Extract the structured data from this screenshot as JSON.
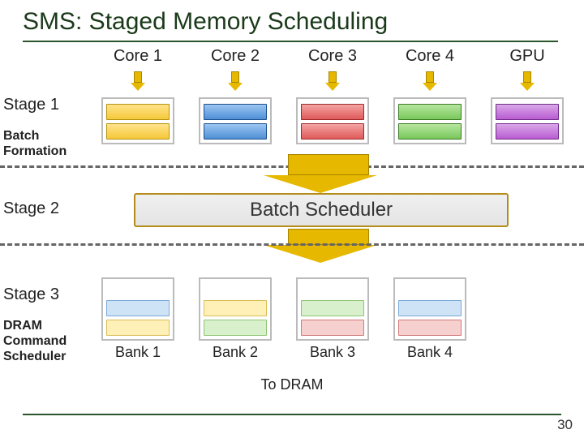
{
  "title": "SMS: Staged Memory Scheduling",
  "cores": [
    "Core 1",
    "Core 2",
    "Core 3",
    "Core 4",
    "GPU"
  ],
  "stage1": {
    "label": "Stage 1",
    "sublabel_line1": "Batch",
    "sublabel_line2": "Formation",
    "queues": [
      {
        "bars": [
          "yellow",
          "yellow"
        ]
      },
      {
        "bars": [
          "blue",
          "blue"
        ]
      },
      {
        "bars": [
          "red",
          "red"
        ]
      },
      {
        "bars": [
          "green",
          "green"
        ]
      },
      {
        "bars": [
          "purple",
          "purple"
        ]
      }
    ]
  },
  "stage2": {
    "label": "Stage 2",
    "box": "Batch Scheduler"
  },
  "stage3": {
    "label": "Stage 3",
    "sublabel_line1": "DRAM",
    "sublabel_line2": "Command",
    "sublabel_line3": "Scheduler",
    "banks": [
      {
        "label": "Bank 1",
        "bars": [
          "blue-l",
          "yellow-l"
        ]
      },
      {
        "label": "Bank 2",
        "bars": [
          "yellow-l",
          "green-l"
        ]
      },
      {
        "label": "Bank 3",
        "bars": [
          "green-l",
          "red-l"
        ]
      },
      {
        "label": "Bank 4",
        "bars": [
          "blue-l",
          "red-l"
        ]
      }
    ]
  },
  "to_dram": "To DRAM",
  "page_number": "30",
  "colors": {
    "accent": "#2a552a",
    "arrow": "#e6b800"
  }
}
